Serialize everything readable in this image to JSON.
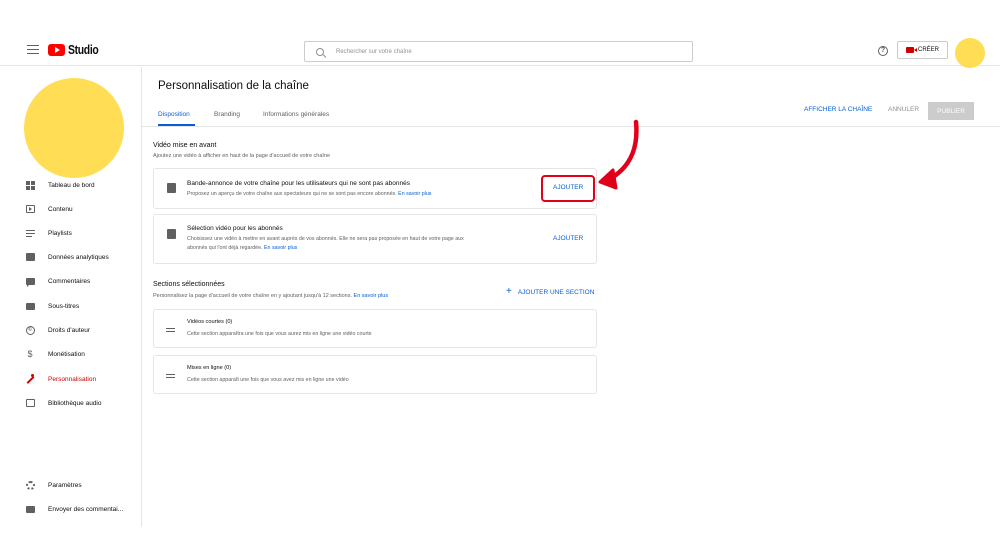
{
  "app": {
    "logo_text": "Studio"
  },
  "search": {
    "placeholder": "Rechercher sur votre chaîne"
  },
  "header": {
    "help_glyph": "?",
    "create_label": "CRÉER"
  },
  "sidebar": {
    "items": [
      {
        "label": "Tableau de bord"
      },
      {
        "label": "Contenu"
      },
      {
        "label": "Playlists"
      },
      {
        "label": "Données analytiques"
      },
      {
        "label": "Commentaires"
      },
      {
        "label": "Sous-titres"
      },
      {
        "label": "Droits d'auteur"
      },
      {
        "label": "Monétisation"
      },
      {
        "label": "Personnalisation"
      },
      {
        "label": "Bibliothèque audio"
      }
    ],
    "footer": [
      {
        "label": "Paramètres"
      },
      {
        "label": "Envoyer des commentai..."
      }
    ],
    "copyright_glyph": "©",
    "dollar_glyph": "$"
  },
  "main": {
    "title": "Personnalisation de la chaîne",
    "tabs": [
      {
        "label": "Disposition"
      },
      {
        "label": "Branding"
      },
      {
        "label": "Informations générales"
      }
    ],
    "actions": {
      "view_channel": "AFFICHER LA CHAÎNE",
      "cancel": "ANNULER",
      "publish": "PUBLIER"
    },
    "featured": {
      "title": "Vidéo mise en avant",
      "description": "Ajoutez une vidéo à afficher en haut de la page d'accueil de votre chaîne",
      "cards": [
        {
          "title": "Bande-annonce de votre chaîne pour les utilisateurs qui ne sont pas abonnés",
          "description": "Proposez un aperçu de votre chaîne aux spectateurs qui ne se sont pas encore abonnés.",
          "link": "En savoir plus",
          "button": "AJOUTER"
        },
        {
          "title": "Sélection vidéo pour les abonnés",
          "description_line1": "Choisissez une vidéo à mettre en avant auprès de vos abonnés. Elle ne sera pas proposée en haut de votre page aux",
          "description_line2": "abonnés qui l'ont déjà regardée.",
          "link": "En savoir plus",
          "button": "AJOUTER"
        }
      ]
    },
    "sections": {
      "title": "Sections sélectionnées",
      "description": "Personnalisez la page d'accueil de votre chaîne en y ajoutant jusqu'à 12 sections.",
      "link": "En savoir plus",
      "add_button": "AJOUTER UNE SECTION",
      "add_glyph": "+",
      "items": [
        {
          "title": "Vidéos courtes (0)",
          "description": "Cette section apparaîtra une fois que vous aurez mis en ligne une vidéo courte"
        },
        {
          "title": "Mises en ligne (0)",
          "description": "Cette section apparaît une fois que vous avez mis en ligne une vidéo"
        }
      ]
    }
  },
  "colors": {
    "brand_red": "#ff0000",
    "accent_blue": "#065fd4",
    "annotation_red": "#e1001a",
    "avatar_yellow": "#ffdd55"
  }
}
